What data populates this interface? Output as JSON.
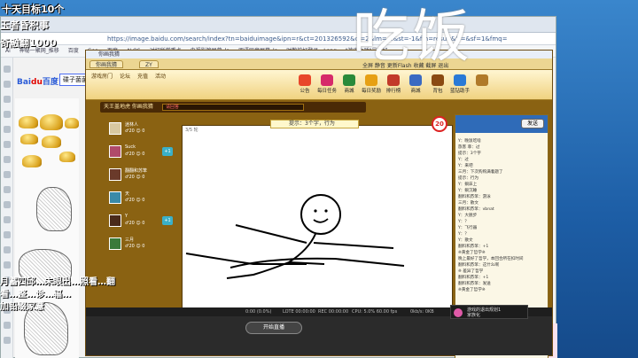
{
  "overlay": {
    "line1": "十天目标10个",
    "line2": "玉者昏积事",
    "line3": "奇融翻1000",
    "big": "吃饭",
    "bottom": "月蓄四邱…未眼出…照看…翻看…整…诊…辐…",
    "bottom2": "加铅缀家薏"
  },
  "browser": {
    "url": "https://image.baidu.com/search/index?tn=baiduimage&ipn=r&ct=201326592&cl=2&lm=-1&st=-1&fm=result&fr=&sf=1&fmq=",
    "bookmarks": [
      "Ai",
      "神秘一聚网_推移",
      "百度",
      "Goo",
      "百度",
      "ALOS",
      "对打所学重点",
      "央视影管屏幕_lo",
      "双语区音屏幕_lo",
      "时数前好登录 - Lang",
      "\"神农之骄\"最新好"
    ],
    "logo_text": "Bai",
    "logo_red": "du",
    "logo_suffix": "百度",
    "search_value": "碟子菌菌"
  },
  "game": {
    "title": "你画我猜",
    "tabs": [
      "你画我猜",
      "ZY"
    ],
    "subtabs": [
      "游戏房门",
      "论坛",
      "充值",
      "活动"
    ],
    "menu_items": [
      {
        "label": "公告",
        "color": "#e8462a"
      },
      {
        "label": "每日任务",
        "color": "#d62a6a"
      },
      {
        "label": "商城",
        "color": "#2a8a3a"
      },
      {
        "label": "每日奖励",
        "color": "#e6a014"
      },
      {
        "label": "排行榜",
        "color": "#c23a2a"
      },
      {
        "label": "商城",
        "color": "#3a6ac2"
      },
      {
        "label": "背包",
        "color": "#8a4a12"
      },
      {
        "label": "蓝钻助手",
        "color": "#2a7ad6"
      },
      {
        "label": "",
        "color": "#b07a2a"
      }
    ],
    "right_links": [
      "全屏",
      "静音",
      "更新Flash",
      "收藏",
      "截屏",
      "退出"
    ],
    "room_title": "天王盖地虎 你画我猜",
    "room_input": "请回答",
    "canvas_counter": "3/5 轮",
    "hint": "提示：3个字，行为",
    "timer": "20",
    "chat_button": "发送",
    "players": [
      {
        "name": "迷林人",
        "avatar_color": "#d8c8a0",
        "icons": "♂20 ☺ 0"
      },
      {
        "name": "Suck",
        "avatar_color": "#b04a6a",
        "icons": "♂20 ☺ 0",
        "badge": "+1"
      },
      {
        "name": "翻翻和苏笨",
        "avatar_color": "#6a3a2a",
        "icons": "♂20 ☺ 0"
      },
      {
        "name": "天",
        "avatar_color": "#3a8aa8",
        "icons": "♂20 ☺ 0"
      },
      {
        "name": "Y",
        "avatar_color": "#4a2a1a",
        "icons": "♂20 ☺ 0",
        "badge": "+1"
      },
      {
        "name": "三月",
        "avatar_color": "#3a7a3a",
        "icons": "♂20 ☺ 0"
      }
    ],
    "chat_lines": [
      "Y：晚饭吃啥",
      "旅客 菲：过",
      "提示：3个字",
      "Y：过",
      "Y：来吧",
      "三月：下次购购满着题了",
      "提示：行为",
      "Y：躺床上",
      "Y：躺沉睡",
      "翻料和苏笨：游泳",
      "三月：散文",
      "翻料和苏笨：vbnat",
      "Y：大脱步",
      "Y：？",
      "Y：飞行器",
      "Y：？",
      "Y：散文",
      "翻料和苏笨：+1",
      "※黄金了哲学※",
      "晚上最好了哲学，本回合所在扣时间",
      "翻料和苏笨：这什么啊",
      "※ 差异了哲学",
      "翻料和苏笨：+1",
      "翻料和苏笨：发送",
      "※黄金了哲学※"
    ],
    "status": [
      "0:00 (0.0%)",
      "LOTE 00:00:00",
      "REC 00:00:00",
      "CPU: 5.0%  60.00 fps",
      "0kb/s: 0KB"
    ],
    "bottom_button": "开始直播"
  },
  "notification": {
    "title": "游戏的退出规划1",
    "sub": "家族化"
  },
  "colors": {
    "accent": "#1d5ea6",
    "game_bg": "#d8b24a",
    "timer": "#dd2222"
  }
}
